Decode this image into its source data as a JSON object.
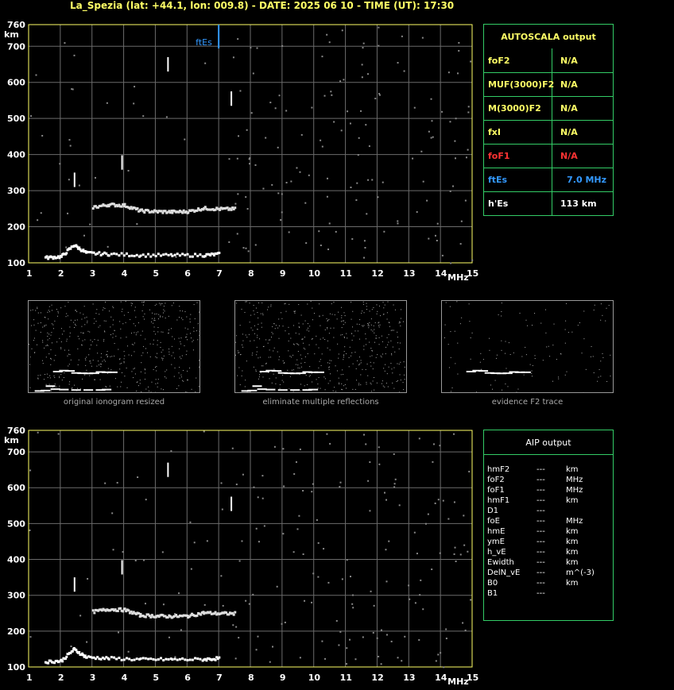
{
  "header": {
    "title": "La_Spezia (lat: +44.1, lon: 009.8) - DATE: 2025 06 10 - TIME (UT): 17:30"
  },
  "chart_data": [
    {
      "type": "scatter",
      "title": "",
      "xlabel": "MHz",
      "ylabel": "km",
      "xlim": [
        1,
        15
      ],
      "ylim": [
        100,
        760
      ],
      "x_ticks": [
        1,
        2,
        3,
        4,
        5,
        6,
        7,
        8,
        9,
        10,
        11,
        12,
        13,
        14,
        15
      ],
      "y_ticks": [
        100,
        200,
        300,
        400,
        500,
        600,
        700,
        760
      ],
      "series": [
        {
          "name": "",
          "points": [
            [
              1.5,
              115
            ],
            [
              2.0,
              118
            ],
            [
              2.4,
              150
            ],
            [
              2.8,
              128
            ],
            [
              3.5,
              125
            ],
            [
              4.5,
              122
            ],
            [
              5.5,
              122
            ],
            [
              6.5,
              122
            ],
            [
              7.0,
              125
            ]
          ]
        },
        {
          "name": "",
          "points": [
            [
              3.0,
              255
            ],
            [
              3.5,
              262
            ],
            [
              4.0,
              260
            ],
            [
              4.5,
              245
            ],
            [
              5.0,
              243
            ],
            [
              5.5,
              242
            ],
            [
              6.0,
              243
            ],
            [
              6.5,
              252
            ],
            [
              7.0,
              250
            ],
            [
              7.5,
              250
            ]
          ]
        }
      ],
      "annotations": [
        {
          "text": "ftEs",
          "x": 7.0
        }
      ],
      "grid": true
    },
    {
      "type": "scatter",
      "title": "",
      "xlabel": "MHz",
      "ylabel": "km",
      "xlim": [
        1,
        15
      ],
      "ylim": [
        100,
        760
      ],
      "x_ticks": [
        1,
        2,
        3,
        4,
        5,
        6,
        7,
        8,
        9,
        10,
        11,
        12,
        13,
        14,
        15
      ],
      "y_ticks": [
        100,
        200,
        300,
        400,
        500,
        600,
        700,
        760
      ],
      "series": [
        {
          "name": "",
          "points": [
            [
              1.5,
              115
            ],
            [
              2.0,
              118
            ],
            [
              2.4,
              150
            ],
            [
              2.8,
              128
            ],
            [
              3.5,
              125
            ],
            [
              4.5,
              122
            ],
            [
              5.5,
              122
            ],
            [
              6.5,
              122
            ],
            [
              7.0,
              125
            ]
          ]
        },
        {
          "name": "",
          "points": [
            [
              3.0,
              255
            ],
            [
              3.5,
              262
            ],
            [
              4.0,
              260
            ],
            [
              4.5,
              245
            ],
            [
              5.0,
              243
            ],
            [
              5.5,
              242
            ],
            [
              6.0,
              243
            ],
            [
              6.5,
              252
            ],
            [
              7.0,
              250
            ],
            [
              7.5,
              250
            ]
          ]
        }
      ],
      "grid": true
    }
  ],
  "autoscala": {
    "title": "AUTOSCALA output",
    "rows": [
      {
        "k": "foF2",
        "v": "N/A",
        "color": "#ffff66"
      },
      {
        "k": "MUF(3000)F2",
        "v": "N/A",
        "color": "#ffff66"
      },
      {
        "k": "M(3000)F2",
        "v": "N/A",
        "color": "#ffff66"
      },
      {
        "k": "fxI",
        "v": "N/A",
        "color": "#ffff66"
      },
      {
        "k": "foF1",
        "v": "N/A",
        "color": "#ff3333"
      },
      {
        "k": "ftEs",
        "v": "7.0 MHz",
        "color": "#3399ff"
      },
      {
        "k": "h'Es",
        "v": "113     km",
        "color": "#ffffff"
      }
    ]
  },
  "thumbnails": [
    {
      "caption": "original ionogram resized"
    },
    {
      "caption": "eliminate multiple reflections"
    },
    {
      "caption": "evidence F2 trace"
    }
  ],
  "aip": {
    "title": "AIP output",
    "rows": [
      {
        "n": "hmF2",
        "d": "---",
        "u": "km"
      },
      {
        "n": "foF2",
        "d": "---",
        "u": "MHz"
      },
      {
        "n": "foF1",
        "d": "---",
        "u": "MHz"
      },
      {
        "n": "hmF1",
        "d": "---",
        "u": "km"
      },
      {
        "n": "D1",
        "d": "---",
        "u": ""
      },
      {
        "n": "foE",
        "d": "---",
        "u": "MHz"
      },
      {
        "n": "hmE",
        "d": "---",
        "u": "km"
      },
      {
        "n": "ymE",
        "d": "---",
        "u": "km"
      },
      {
        "n": "h_vE",
        "d": "---",
        "u": "km"
      },
      {
        "n": "Ewidth",
        "d": "---",
        "u": "km"
      },
      {
        "n": "DelN_vE",
        "d": "---",
        "u": "m^(-3)"
      },
      {
        "n": "B0",
        "d": "---",
        "u": "km"
      },
      {
        "n": "B1",
        "d": "---",
        "u": ""
      }
    ]
  },
  "colors": {
    "grid": "#6b6b6b",
    "axis": "#ffff66",
    "frame": "#33cc66",
    "es": "#3399ff"
  }
}
